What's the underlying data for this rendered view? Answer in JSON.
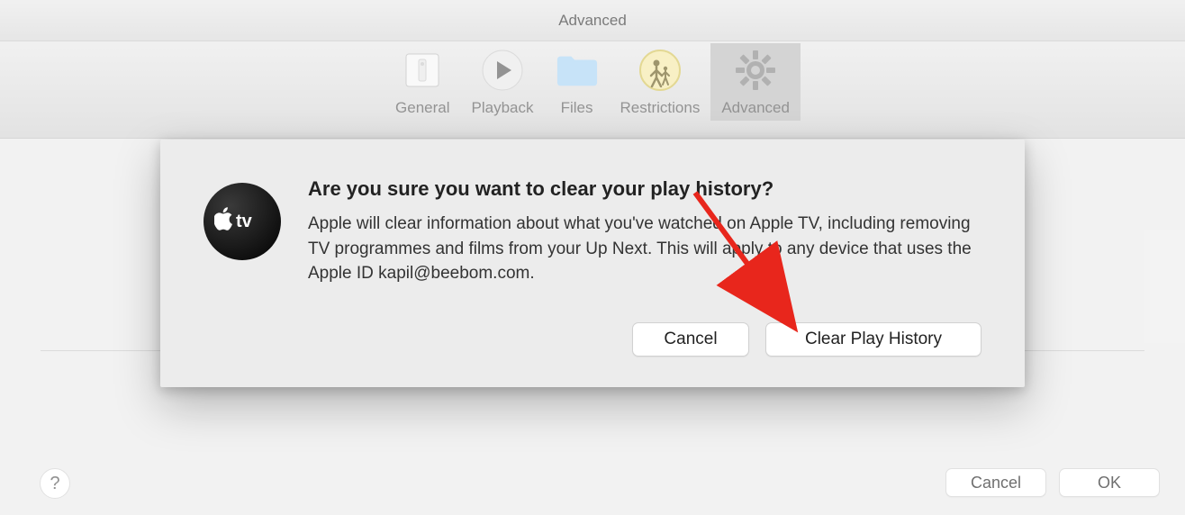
{
  "window": {
    "title": "Advanced"
  },
  "toolbar": {
    "items": [
      {
        "label": "General"
      },
      {
        "label": "Playback"
      },
      {
        "label": "Files"
      },
      {
        "label": "Restrictions"
      },
      {
        "label": "Advanced"
      }
    ]
  },
  "bottom": {
    "cancel": "Cancel",
    "ok": "OK",
    "help": "?"
  },
  "dialog": {
    "title": "Are you sure you want to clear your play history?",
    "message": "Apple will clear information about what you've watched on Apple TV, including removing TV programmes and films from your Up Next. This will apply to any device that uses the Apple ID kapil@beebom.com.",
    "cancel": "Cancel",
    "confirm": "Clear Play History"
  }
}
